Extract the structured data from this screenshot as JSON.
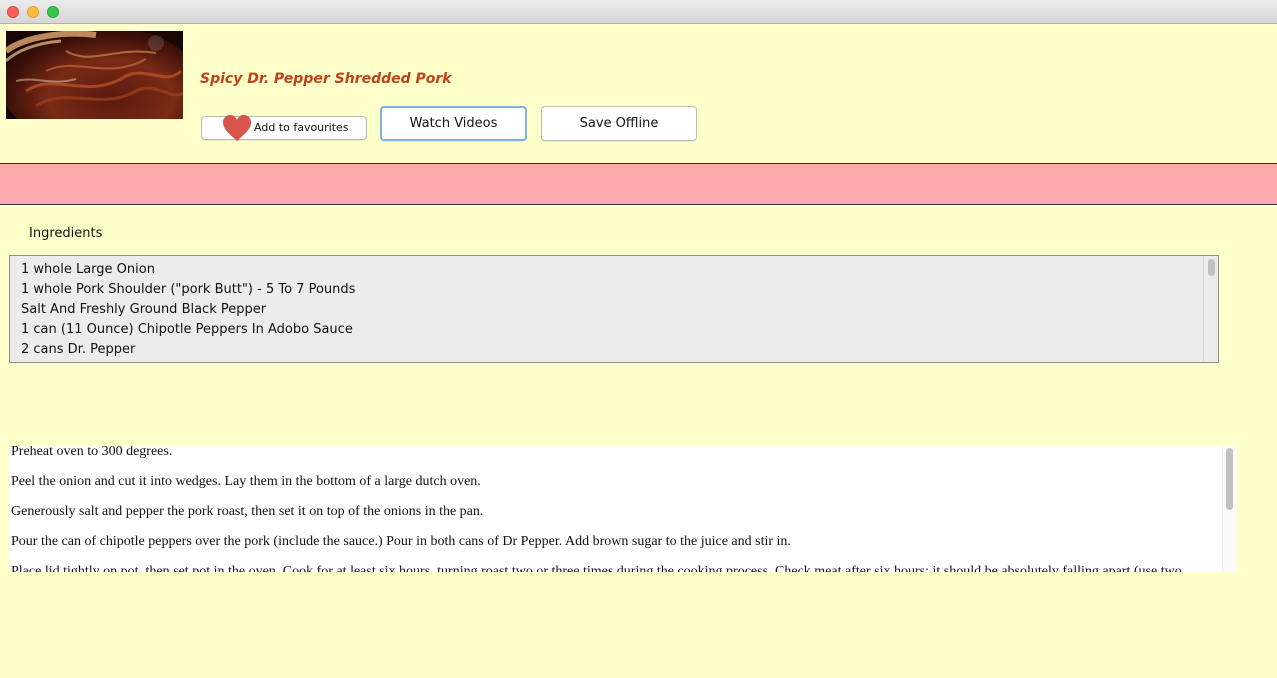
{
  "window": {
    "controls": [
      "close-icon",
      "minimize-icon",
      "maximize-icon"
    ]
  },
  "recipe": {
    "title": "Spicy Dr. Pepper Shredded Pork"
  },
  "actions": {
    "favourite_label": "Add to favourites",
    "favourite_icon": "heart-icon",
    "watch_videos_label": "Watch Videos",
    "save_offline_label": "Save Offline"
  },
  "colors": {
    "background": "#ffffc9",
    "band": "#ffaaaa",
    "title": "#c0421c",
    "heart": "#d9544a"
  },
  "ingredients": {
    "heading": "Ingredients",
    "items": [
      "1 whole Large Onion",
      "1 whole Pork Shoulder (\"pork Butt\") - 5 To 7 Pounds",
      "Salt And Freshly Ground Black Pepper",
      "1 can (11 Ounce) Chipotle Peppers In Adobo Sauce",
      "2 cans Dr. Pepper"
    ]
  },
  "directions": {
    "steps": [
      "Preheat oven to 300 degrees.",
      "Peel the onion and cut it into wedges. Lay them in the bottom of a large dutch oven.",
      "Generously salt and pepper the pork roast, then set it on top of the onions in the pan.",
      "Pour the can of chipotle peppers over the pork (include the sauce.) Pour in both cans of Dr Pepper. Add brown sugar to the juice and stir in.",
      "Place lid tightly on pot, then set pot in the oven. Cook for at least six hours, turning roast two or three times during the cooking process. Check meat after six hours; it should be absolutely falling apart (use two"
    ]
  }
}
